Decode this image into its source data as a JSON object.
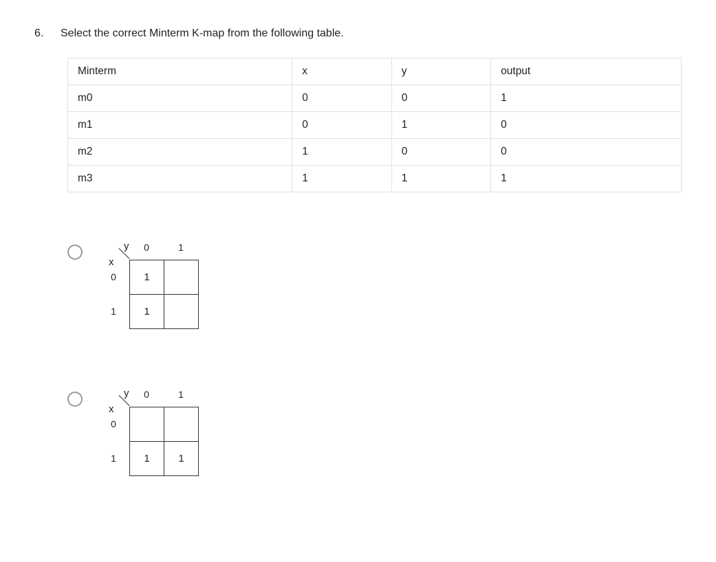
{
  "question": {
    "number": "6.",
    "text": "Select the correct Minterm K-map from the following table."
  },
  "truth_table": {
    "headers": [
      "Minterm",
      "x",
      "y",
      "output"
    ],
    "rows": [
      [
        "m0",
        "0",
        "0",
        "1"
      ],
      [
        "m1",
        "0",
        "1",
        "0"
      ],
      [
        "m2",
        "1",
        "0",
        "0"
      ],
      [
        "m3",
        "1",
        "1",
        "1"
      ]
    ]
  },
  "kmap_labels": {
    "x_var": "x",
    "y_var": "y",
    "col_labels": [
      "0",
      "1"
    ],
    "row_labels": [
      "0",
      "1"
    ]
  },
  "options": [
    {
      "cells": [
        [
          "1",
          ""
        ],
        [
          "1",
          ""
        ]
      ]
    },
    {
      "cells": [
        [
          "",
          ""
        ],
        [
          "1",
          "1"
        ]
      ]
    }
  ]
}
